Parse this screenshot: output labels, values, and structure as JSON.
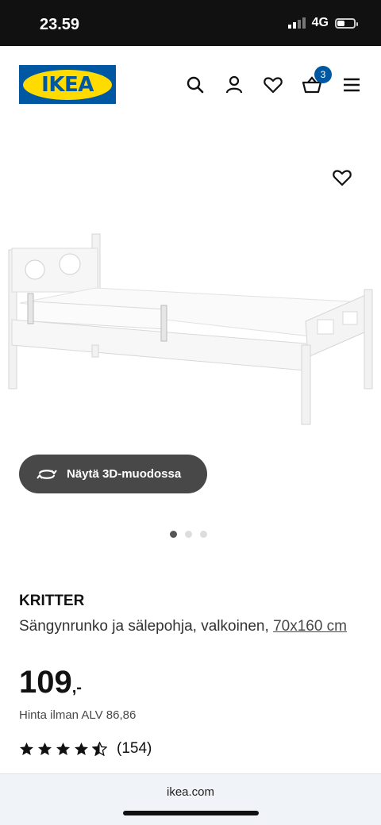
{
  "status_bar": {
    "time": "23.59",
    "network": "4G"
  },
  "header": {
    "logo_text": "IKEA",
    "cart_count": "3"
  },
  "gallery": {
    "view_3d_label": "Näytä 3D-muodossa",
    "dots": 3,
    "active_dot": 0
  },
  "product": {
    "name": "KRITTER",
    "description": "Sängynrunko ja sälepohja, valkoinen,",
    "size_link": "70x160 cm",
    "price": "109",
    "price_suffix": ",-",
    "vat_note": "Hinta ilman ALV 86,86",
    "rating": 4.5,
    "review_count": "(154)"
  },
  "browser": {
    "url": "ikea.com"
  },
  "colors": {
    "ikea_blue": "#0058a3",
    "ikea_yellow": "#ffdb00",
    "button_dark": "#484848"
  }
}
